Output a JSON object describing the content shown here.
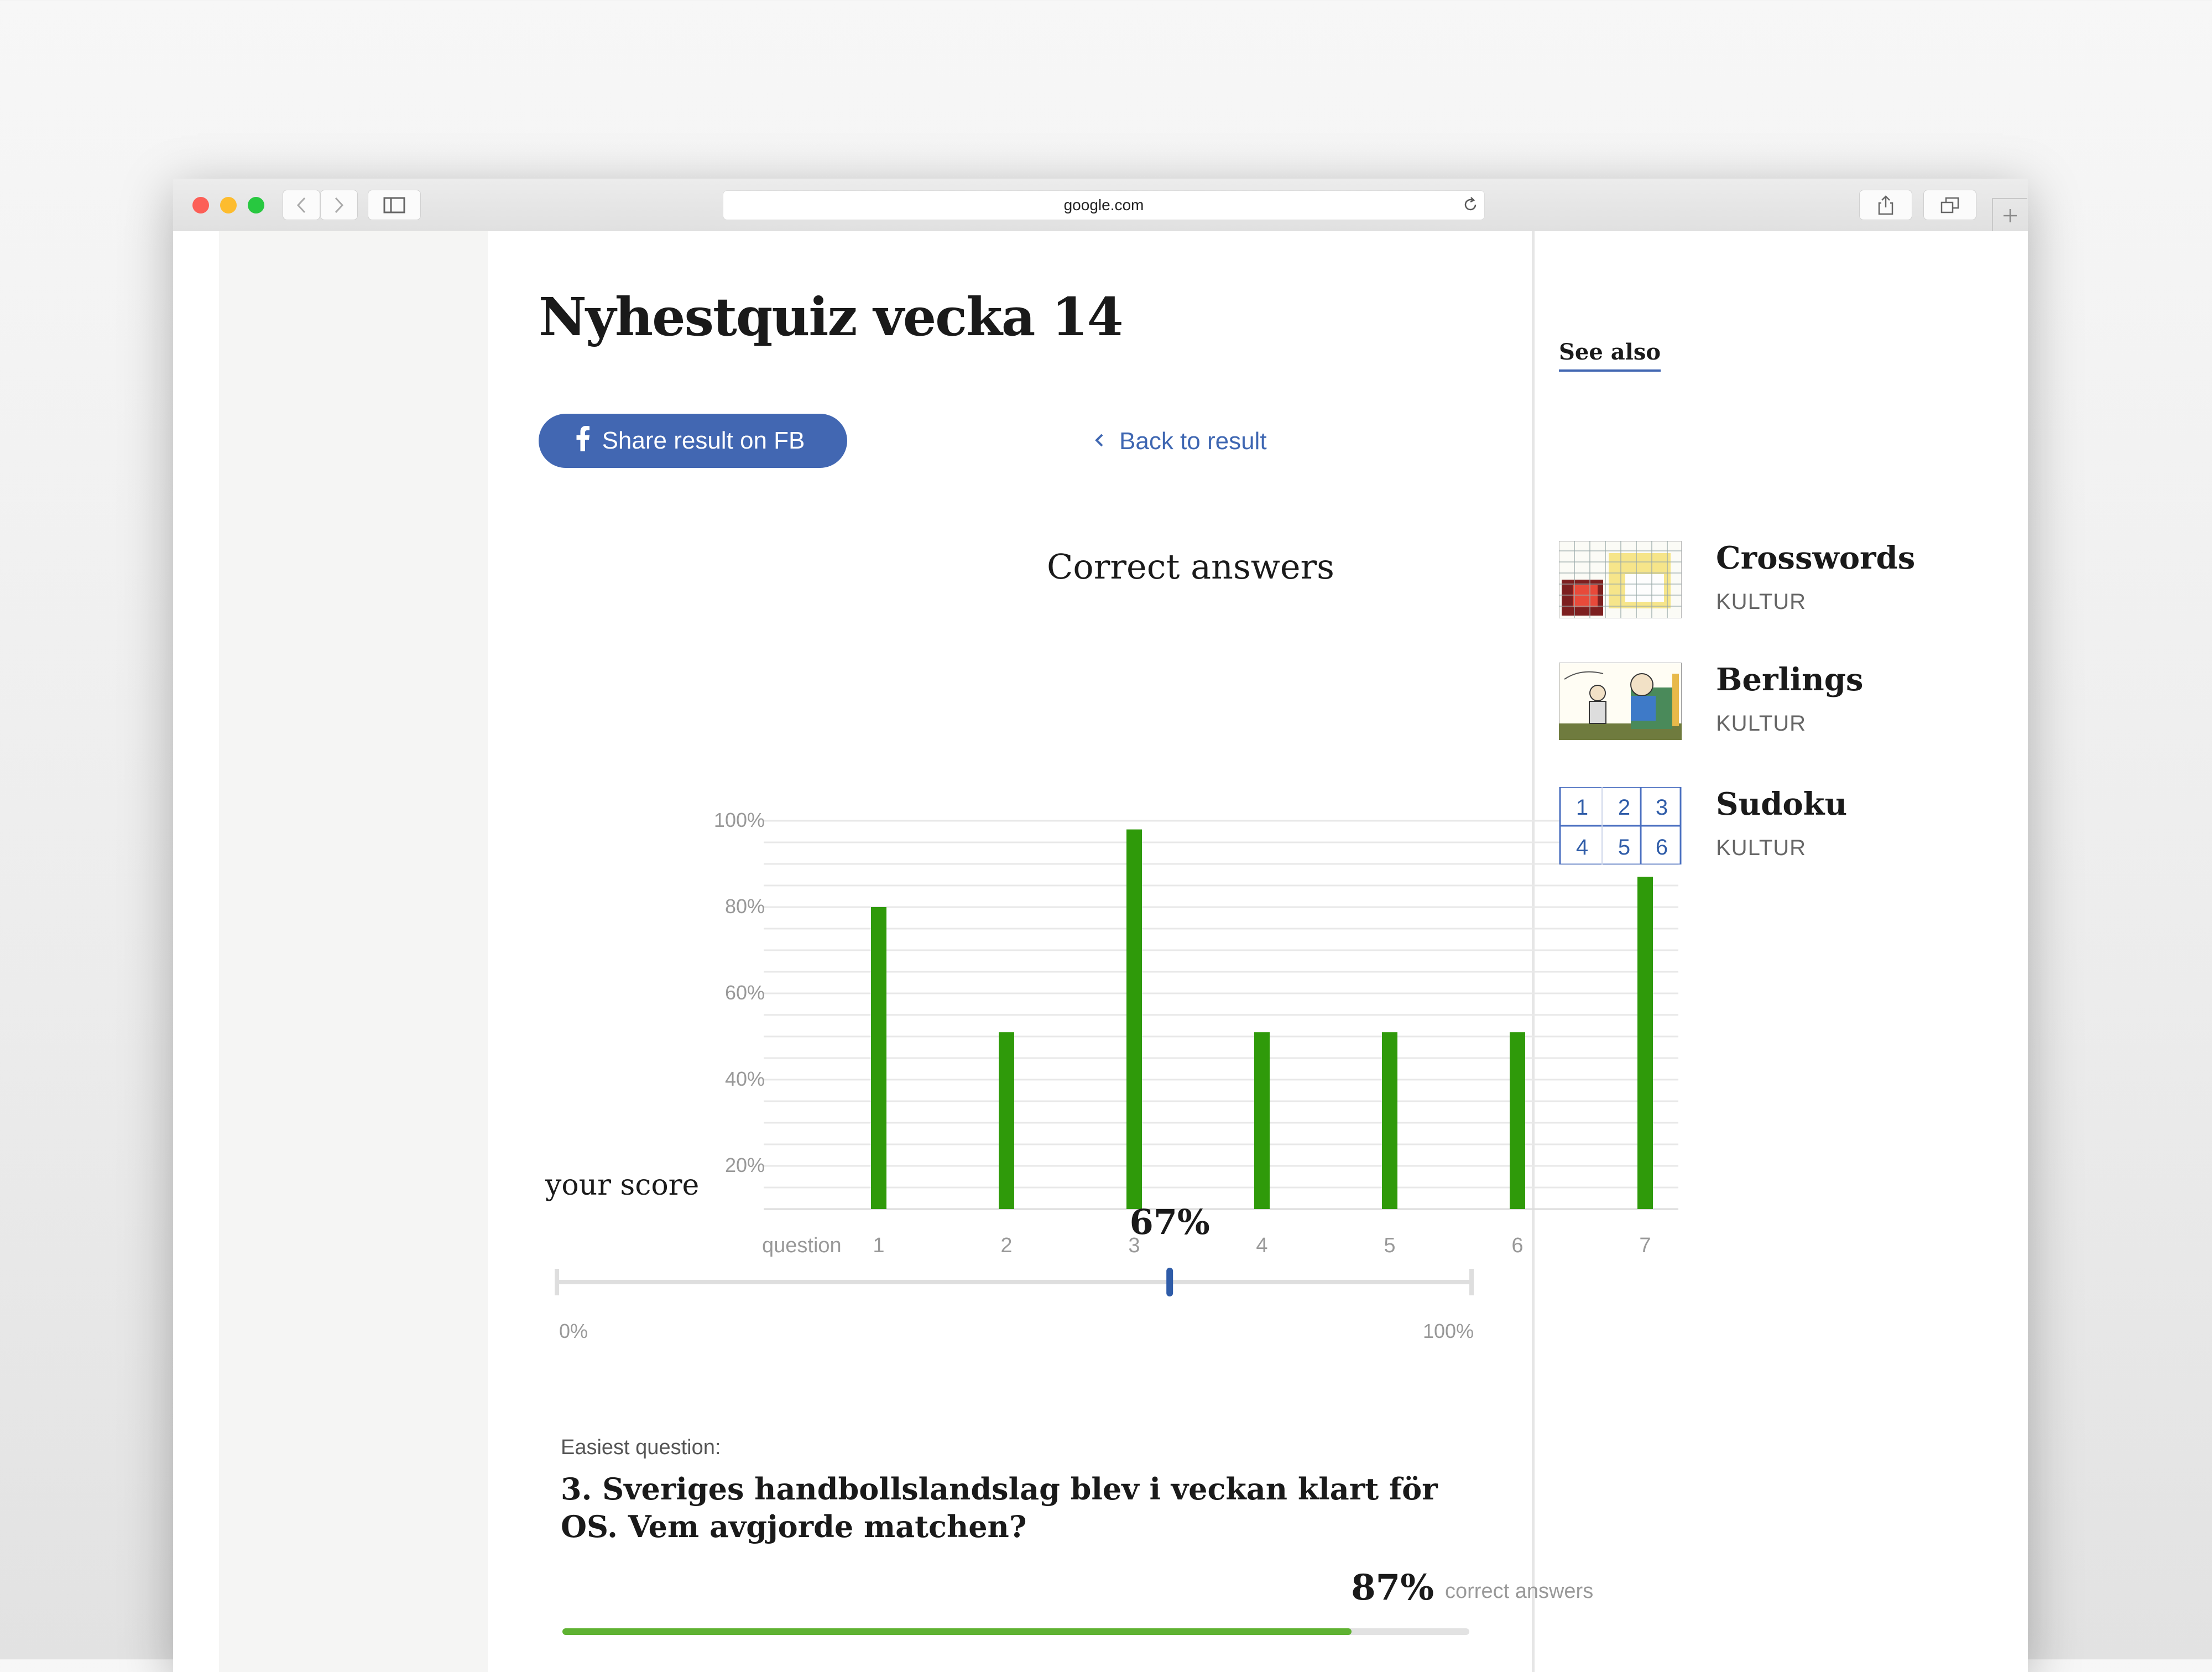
{
  "browser": {
    "url": "google.com",
    "icons": [
      "close-light",
      "minimize-light",
      "zoom-light",
      "back-arrow-icon",
      "forward-arrow-icon",
      "sidebar-icon",
      "reload-icon",
      "share-icon",
      "tabs-icon",
      "plus-icon"
    ]
  },
  "page": {
    "title": "Nyhestquiz vecka 14",
    "share_button": "Share result on FB",
    "back_link": "Back to result"
  },
  "chart_data": {
    "type": "bar",
    "title": "Correct answers",
    "xlabel": "question",
    "ylabel": "",
    "categories": [
      "1",
      "2",
      "3",
      "4",
      "5",
      "6",
      "7"
    ],
    "values": [
      80,
      51,
      98,
      51,
      51,
      51,
      87
    ],
    "yticks": [
      "100%",
      "80%",
      "60%",
      "40%",
      "20%"
    ],
    "ylim": [
      10,
      100
    ],
    "grid": true,
    "bar_color": "#2f9a0a"
  },
  "score": {
    "label": "your score",
    "value_text": "67%",
    "value": 0.67,
    "min_label": "0%",
    "max_label": "100%",
    "marker_color": "#2f5ca8"
  },
  "easiest": {
    "label": "Easiest question:",
    "question": "3. Sveriges handbollslandslag blev i veckan klart för OS. Vem avgjorde matchen?",
    "percent_text": "87%",
    "percent_suffix": "correct answers",
    "fraction": 0.87,
    "bar_color": "#5fb232"
  },
  "sidebar": {
    "heading": "See also",
    "items": [
      {
        "title": "Crosswords",
        "category": "KULTUR",
        "icon": "crossword-thumbnail"
      },
      {
        "title": "Berlings",
        "category": "KULTUR",
        "icon": "comic-thumbnail"
      },
      {
        "title": "Sudoku",
        "category": "KULTUR",
        "icon": "sudoku-thumbnail",
        "grid": [
          "1",
          "2",
          "3",
          "4",
          "5",
          "6"
        ]
      }
    ]
  }
}
